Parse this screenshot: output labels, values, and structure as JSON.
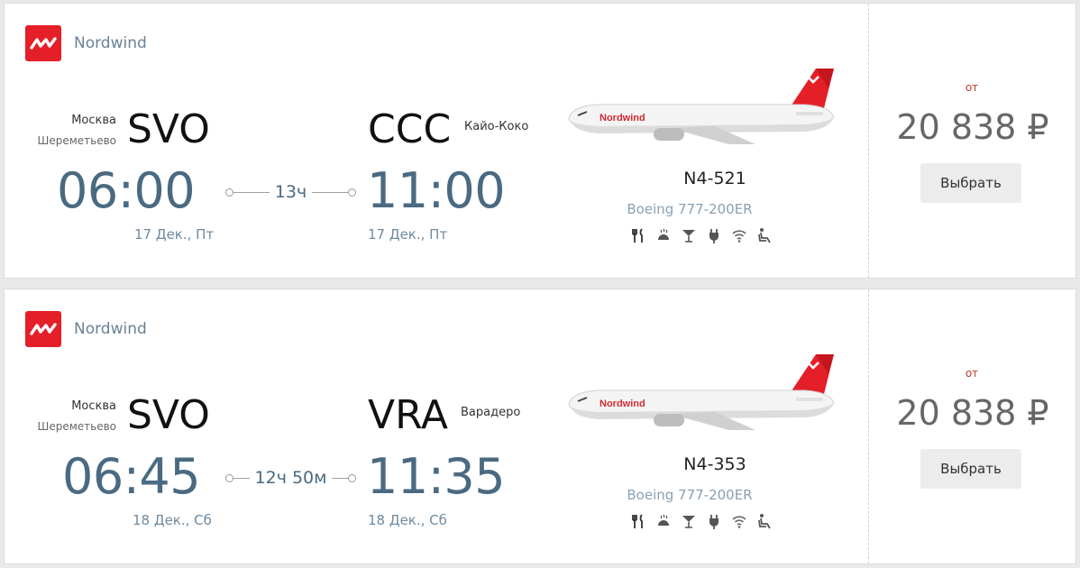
{
  "flights": [
    {
      "airline": "Nordwind",
      "origin": {
        "city": "Москва",
        "airport": "Шереметьево",
        "code": "SVO",
        "time": "06:00",
        "date": "17 Дек., Пт"
      },
      "destination": {
        "city": "Кайо-Коко",
        "code": "CCC",
        "time": "11:00",
        "date": "17 Дек., Пт"
      },
      "duration": "13ч",
      "flight_number": "N4-521",
      "aircraft": "Boeing 777-200ER",
      "price_prefix": "от",
      "price": "20 838 ₽",
      "select_label": "Выбрать"
    },
    {
      "airline": "Nordwind",
      "origin": {
        "city": "Москва",
        "airport": "Шереметьево",
        "code": "SVO",
        "time": "06:45",
        "date": "18 Дек., Сб"
      },
      "destination": {
        "city": "Варадеро",
        "code": "VRA",
        "time": "11:35",
        "date": "18 Дек., Сб"
      },
      "duration": "12ч 50м",
      "flight_number": "N4-353",
      "aircraft": "Boeing 777-200ER",
      "price_prefix": "от",
      "price": "20 838 ₽",
      "select_label": "Выбрать"
    }
  ],
  "plane_livery_text": "Nordwind",
  "amenity_icons": [
    "meal-icon",
    "hot-meal-icon",
    "drinks-icon",
    "power-outlet-icon",
    "wifi-icon",
    "seat-icon"
  ],
  "colors": {
    "brand": "#e51f28",
    "time": "#4a6a82",
    "price": "#666666",
    "accent_label": "#c0392b"
  }
}
